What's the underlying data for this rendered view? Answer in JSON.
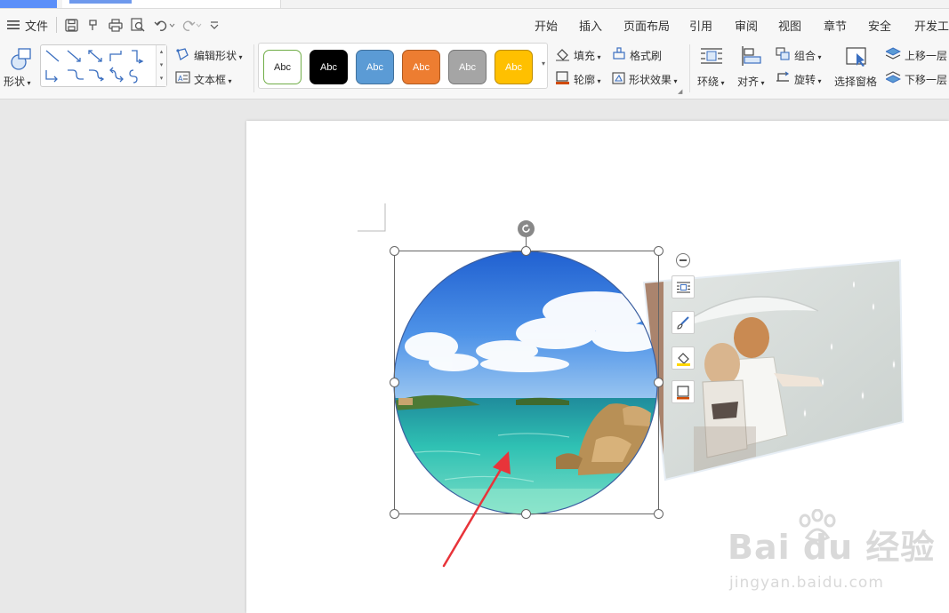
{
  "quick_access": {
    "file_label": "文件"
  },
  "menu_tabs": [
    "开始",
    "插入",
    "页面布局",
    "引用",
    "审阅",
    "视图",
    "章节",
    "安全",
    "开发工具"
  ],
  "ribbon": {
    "shapes_label": "形状",
    "edit_shape_label": "编辑形状",
    "text_box_label": "文本框",
    "style_samples": [
      {
        "label": "Abc",
        "bg": "#ffffff",
        "fg": "#222222",
        "border": "#70ad47"
      },
      {
        "label": "Abc",
        "bg": "#000000",
        "fg": "#ffffff",
        "border": "#000000"
      },
      {
        "label": "Abc",
        "bg": "#5b9bd5",
        "fg": "#ffffff",
        "border": "#41719c"
      },
      {
        "label": "Abc",
        "bg": "#ed7d31",
        "fg": "#ffffff",
        "border": "#ae5a21"
      },
      {
        "label": "Abc",
        "bg": "#a5a5a5",
        "fg": "#ffffff",
        "border": "#787878"
      },
      {
        "label": "Abc",
        "bg": "#ffc000",
        "fg": "#ffffff",
        "border": "#bc8c00"
      }
    ],
    "fill_label": "填充",
    "format_painter_label": "格式刷",
    "outline_label": "轮廓",
    "shape_effects_label": "形状效果",
    "wrap_label": "环绕",
    "align_label": "对齐",
    "group_label": "组合",
    "rotate_label": "旋转",
    "selection_pane_label": "选择窗格",
    "bring_forward_label": "上移一层",
    "send_backward_label": "下移一层"
  },
  "watermark": {
    "text": "Bai du 经验",
    "url": "jingyan.baidu.com"
  },
  "colors": {
    "accent": "#4a7fe8",
    "arrow": "#e8343a",
    "handle_border": "#666666"
  }
}
